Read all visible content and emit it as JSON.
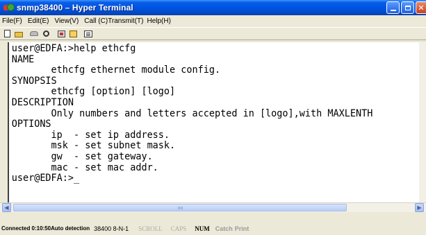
{
  "window": {
    "title": "snmp38400 – Hyper Terminal"
  },
  "menu": [
    "File(F)",
    "Edit(E)",
    "View(V)",
    "Call (C)",
    "Transmit(T)",
    "Help(H)"
  ],
  "toolbar_icons": [
    "new-icon",
    "open-icon",
    "call-icon",
    "disconnect-icon",
    "send-icon",
    "receive-icon",
    "properties-icon"
  ],
  "terminal": {
    "lines": [
      "user@EDFA:>help ethcfg",
      "NAME",
      "       ethcfg ethernet module config.",
      "SYNOPSIS",
      "       ethcfg [option] [logo]",
      "DESCRIPTION",
      "       Only numbers and letters accepted in [logo],with MAXLENTH",
      "OPTIONS",
      "       ip  - set ip address.",
      "       msk - set subnet mask.",
      "       gw  - set gateway.",
      "       mac - set mac addr.",
      "user@EDFA:>_"
    ]
  },
  "status": {
    "connected": "Connected 0:10:50",
    "detection": "Auto detection",
    "baud": "38400 8-N-1",
    "scroll": "SCROLL",
    "caps": "CAPS",
    "num": "NUM",
    "capture": "Catch",
    "print": "Print"
  },
  "colors": {
    "titlebar": "#0054e3",
    "chrome": "#ece9d8",
    "terminal_bg": "#ffffff",
    "close_button": "#c8411f"
  }
}
